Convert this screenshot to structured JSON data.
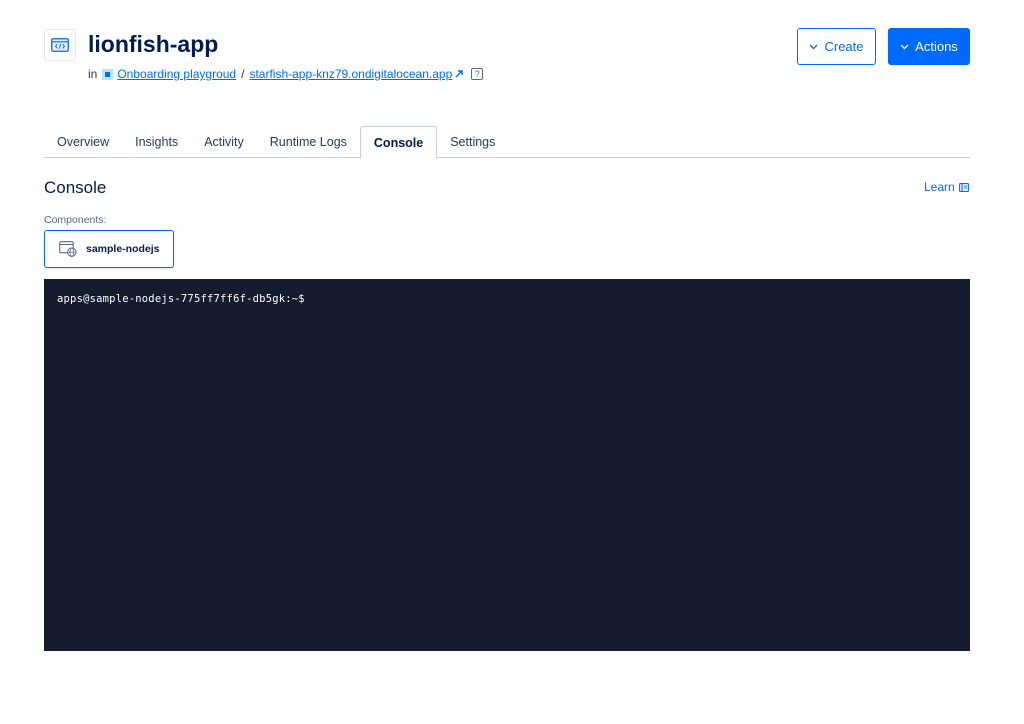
{
  "header": {
    "app_name": "lionfish-app",
    "in_label": "in",
    "project_link": "Onboarding playgroud",
    "separator": "/",
    "app_url_link": "starfish-app-knz79.ondigitalocean.app",
    "help_glyph": "?",
    "icons": {
      "app": "code-window-icon",
      "external": "external-link-icon",
      "help": "help-icon"
    }
  },
  "actions": {
    "create_label": "Create",
    "actions_label": "Actions"
  },
  "tabs": [
    {
      "label": "Overview",
      "active": false
    },
    {
      "label": "Insights",
      "active": false
    },
    {
      "label": "Activity",
      "active": false
    },
    {
      "label": "Runtime Logs",
      "active": false
    },
    {
      "label": "Console",
      "active": true
    },
    {
      "label": "Settings",
      "active": false
    }
  ],
  "console": {
    "title": "Console",
    "learn_label": "Learn",
    "components_label": "Components:",
    "component_name": "sample-nodejs",
    "terminal_prompt": "apps@sample-nodejs-775ff7ff6f-db5gk:~$"
  },
  "colors": {
    "accent": "#0069ff",
    "text_primary": "#031b4e",
    "terminal_bg": "#151c2e",
    "project_square": "#b5e8f4"
  }
}
